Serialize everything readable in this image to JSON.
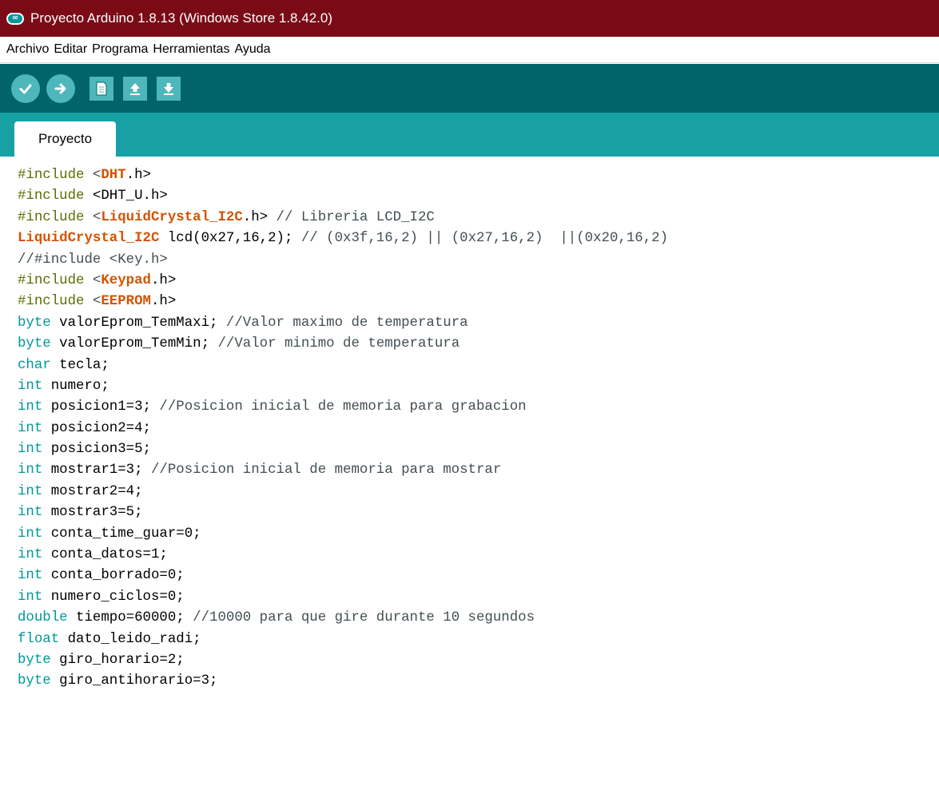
{
  "window": {
    "title": "Proyecto Arduino 1.8.13 (Windows Store 1.8.42.0)",
    "logo_icon": "arduino-infinity-icon",
    "logo_glyph": "∞"
  },
  "menu": [
    {
      "label": "Archivo"
    },
    {
      "label": "Editar"
    },
    {
      "label": "Programa"
    },
    {
      "label": "Herramientas"
    },
    {
      "label": "Ayuda"
    }
  ],
  "toolbar": {
    "buttons": [
      {
        "name": "verify-button",
        "icon": "check-icon",
        "shape": "round"
      },
      {
        "name": "upload-button",
        "icon": "arrow-right-icon",
        "shape": "round"
      },
      {
        "name": "new-button",
        "icon": "new-document-icon",
        "shape": "square"
      },
      {
        "name": "open-button",
        "icon": "open-arrow-up-icon",
        "shape": "square"
      },
      {
        "name": "save-button",
        "icon": "save-arrow-down-icon",
        "shape": "square"
      }
    ]
  },
  "tabs": [
    {
      "label": "Proyecto",
      "active": true
    }
  ],
  "colors": {
    "titlebar": "#7a0b16",
    "toolbar": "#006468",
    "tabbar": "#17a1a5",
    "button": "#4db7bb",
    "preprocessor": "#5e6d03",
    "library": "#d35400",
    "type_keyword": "#00979c",
    "comment": "#434f54"
  },
  "code_lines": [
    [
      {
        "t": "#include ",
        "k": "pre"
      },
      {
        "t": "<",
        "k": "sym"
      },
      {
        "t": "DHT",
        "k": "lib"
      },
      {
        "t": ".h>",
        "k": "plain"
      }
    ],
    [
      {
        "t": "#include ",
        "k": "pre"
      },
      {
        "t": "<DHT_U.h>",
        "k": "plain"
      }
    ],
    [
      {
        "t": "#include ",
        "k": "pre"
      },
      {
        "t": "<",
        "k": "sym"
      },
      {
        "t": "LiquidCrystal_I2C",
        "k": "lib"
      },
      {
        "t": ".h>",
        "k": "plain"
      },
      {
        "t": " // Libreria LCD_I2C",
        "k": "com"
      }
    ],
    [
      {
        "t": "LiquidCrystal_I2C",
        "k": "lib"
      },
      {
        "t": " lcd(0x27,16,2);",
        "k": "plain"
      },
      {
        "t": " // (0x3f,16,2) || (0x27,16,2)  ||(0x20,16,2)",
        "k": "com"
      }
    ],
    [
      {
        "t": "//#include <Key.h>",
        "k": "com"
      }
    ],
    [
      {
        "t": "#include ",
        "k": "pre"
      },
      {
        "t": "<",
        "k": "sym"
      },
      {
        "t": "Keypad",
        "k": "lib"
      },
      {
        "t": ".h>",
        "k": "plain"
      }
    ],
    [
      {
        "t": "#include ",
        "k": "pre"
      },
      {
        "t": "<",
        "k": "sym"
      },
      {
        "t": "EEPROM",
        "k": "lib"
      },
      {
        "t": ".h>",
        "k": "plain"
      }
    ],
    [
      {
        "t": "byte",
        "k": "type"
      },
      {
        "t": " valorEprom_TemMaxi;",
        "k": "plain"
      },
      {
        "t": " //Valor maximo de temperatura",
        "k": "com"
      }
    ],
    [
      {
        "t": "byte",
        "k": "type"
      },
      {
        "t": " valorEprom_TemMin;",
        "k": "plain"
      },
      {
        "t": " //Valor minimo de temperatura",
        "k": "com"
      }
    ],
    [
      {
        "t": "char",
        "k": "type"
      },
      {
        "t": " tecla;",
        "k": "plain"
      }
    ],
    [
      {
        "t": "int",
        "k": "type"
      },
      {
        "t": " numero;",
        "k": "plain"
      }
    ],
    [
      {
        "t": "int",
        "k": "type"
      },
      {
        "t": " posicion1=3;",
        "k": "plain"
      },
      {
        "t": " //Posicion inicial de memoria para grabacion",
        "k": "com"
      }
    ],
    [
      {
        "t": "int",
        "k": "type"
      },
      {
        "t": " posicion2=4;",
        "k": "plain"
      }
    ],
    [
      {
        "t": "int",
        "k": "type"
      },
      {
        "t": " posicion3=5;",
        "k": "plain"
      }
    ],
    [
      {
        "t": "int",
        "k": "type"
      },
      {
        "t": " mostrar1=3;",
        "k": "plain"
      },
      {
        "t": " //Posicion inicial de memoria para mostrar",
        "k": "com"
      }
    ],
    [
      {
        "t": "int",
        "k": "type"
      },
      {
        "t": " mostrar2=4;",
        "k": "plain"
      }
    ],
    [
      {
        "t": "int",
        "k": "type"
      },
      {
        "t": " mostrar3=5;",
        "k": "plain"
      }
    ],
    [
      {
        "t": "int",
        "k": "type"
      },
      {
        "t": " conta_time_guar=0;",
        "k": "plain"
      }
    ],
    [
      {
        "t": "int",
        "k": "type"
      },
      {
        "t": " conta_datos=1;",
        "k": "plain"
      }
    ],
    [
      {
        "t": "int",
        "k": "type"
      },
      {
        "t": " conta_borrado=0;",
        "k": "plain"
      }
    ],
    [
      {
        "t": "int",
        "k": "type"
      },
      {
        "t": " numero_ciclos=0;",
        "k": "plain"
      }
    ],
    [
      {
        "t": "double",
        "k": "type"
      },
      {
        "t": " tiempo=60000;",
        "k": "plain"
      },
      {
        "t": " //10000 para que gire durante 10 segundos",
        "k": "com"
      }
    ],
    [
      {
        "t": "float",
        "k": "type"
      },
      {
        "t": " dato_leido_radi;",
        "k": "plain"
      }
    ],
    [
      {
        "t": "byte",
        "k": "type"
      },
      {
        "t": " giro_horario=2;",
        "k": "plain"
      }
    ],
    [
      {
        "t": "byte",
        "k": "type"
      },
      {
        "t": " giro_antihorario=3;",
        "k": "plain"
      }
    ]
  ]
}
